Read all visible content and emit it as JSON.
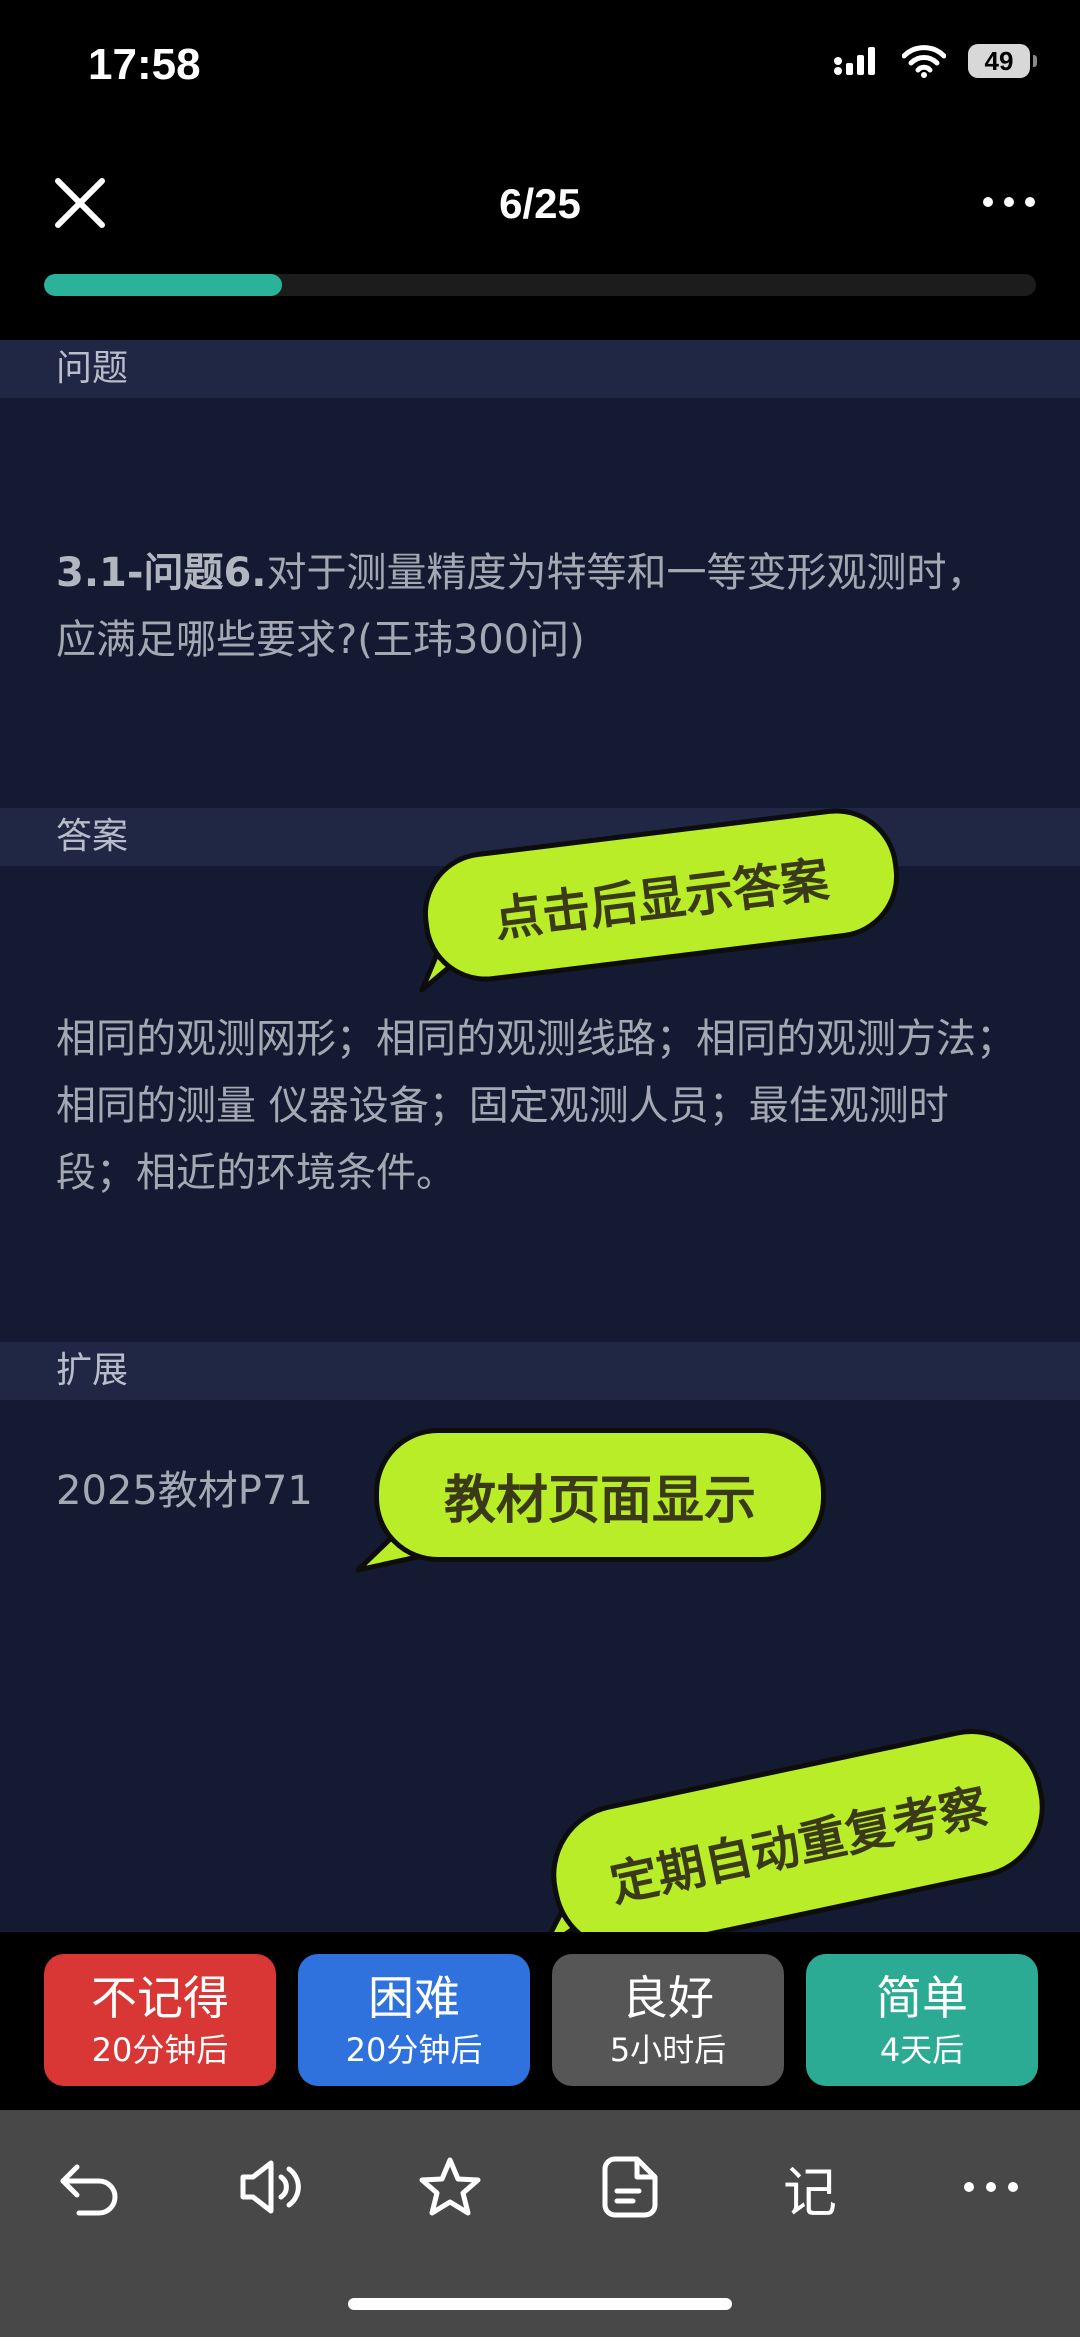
{
  "status_bar": {
    "time": "17:58",
    "battery": "49"
  },
  "header": {
    "counter": "6/25",
    "progress_fraction": 0.24
  },
  "question": {
    "header": "问题",
    "prefix": "3.1-问题6.",
    "text": "对于测量精度为特等和一等变形观测时， 应满足哪些要求?(王玮300问)"
  },
  "answer": {
    "header": "答案",
    "text": "相同的观测网形；相同的观测线路；相同的观测方法；相同的测量 仪器设备；固定观测人员；最佳观测时段；相近的环境条件。"
  },
  "extension": {
    "header": "扩展",
    "text": "2025教材P71"
  },
  "callouts": {
    "show_answer": "点击后显示答案",
    "textbook": "教材页面显示",
    "review": "定期自动重复考察"
  },
  "ratings": [
    {
      "label": "不记得",
      "sub": "20分钟后",
      "color": "#d93636"
    },
    {
      "label": "困难",
      "sub": "20分钟后",
      "color": "#2f72de"
    },
    {
      "label": "良好",
      "sub": "5小时后",
      "color": "#565656"
    },
    {
      "label": "简单",
      "sub": "4天后",
      "color": "#2bab94"
    }
  ],
  "toolbar": {
    "note_glyph": "记"
  },
  "colors": {
    "accent": "#2ab39a",
    "callout": "#b8ed28",
    "card": "#141a31"
  }
}
